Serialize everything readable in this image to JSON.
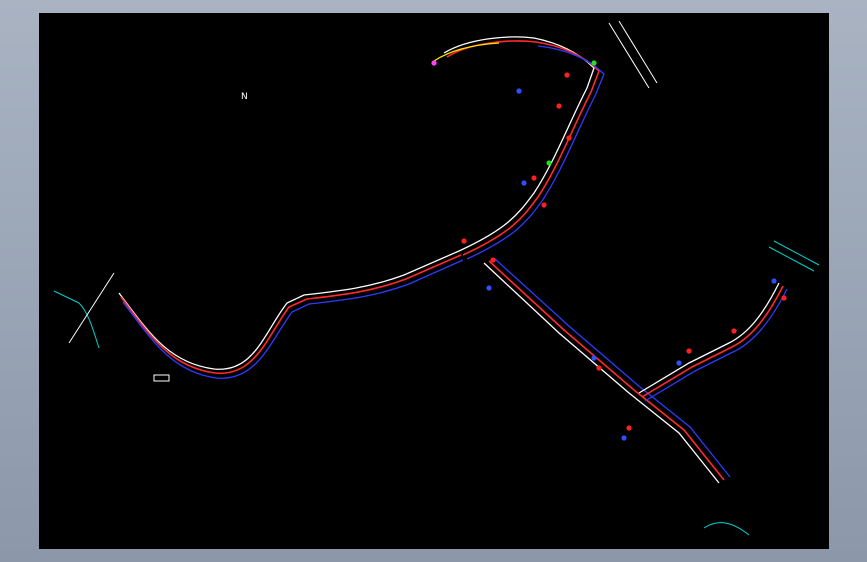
{
  "drawing": {
    "background": "#000000",
    "frame_color": "#9aa5b6",
    "colors": {
      "road_edge": "#ffffff",
      "centerline": "#ff2a2a",
      "offset_line": "#2a3cff",
      "kerb": "#ffe600",
      "water": "#00d0d0",
      "marker_red": "#ff2020",
      "marker_blue": "#3050ff",
      "marker_green": "#20e020",
      "marker_magenta": "#ff40ff"
    },
    "text_labels": [
      "N"
    ]
  }
}
